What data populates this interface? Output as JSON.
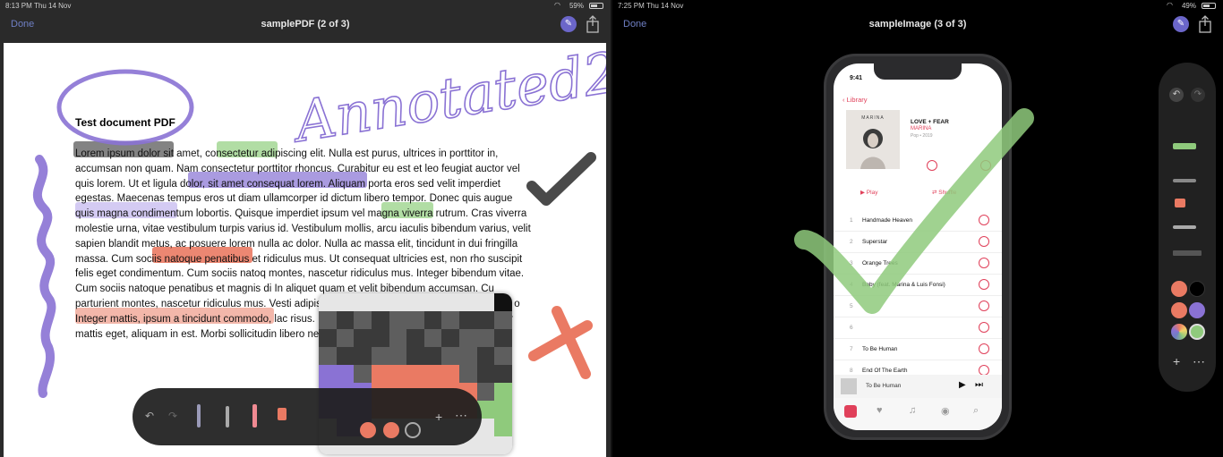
{
  "left": {
    "status": {
      "time": "8:13 PM",
      "date": "Thu 14 Nov",
      "battery": "59%"
    },
    "nav": {
      "done": "Done",
      "title": "samplePDF (2 of 3)"
    },
    "pdf": {
      "heading": "Test document PDF",
      "body": "Lorem ipsum dolor sit amet, consectetur adipiscing elit. Nulla est purus, ultrices in porttitor in, accumsan non quam. Nam consectetur porttitor rhoncus. Curabitur eu est et leo feugiat auctor vel quis lorem. Ut et ligula dolor, sit amet consequat lorem. Aliquam porta eros sed velit imperdiet egestas. Maecenas tempus eros ut diam ullamcorper id dictum libero tempor. Donec quis augue quis magna condimentum lobortis. Quisque imperdiet ipsum vel magna viverra rutrum. Cras viverra molestie urna, vitae vestibulum turpis varius id. Vestibulum mollis, arcu iaculis bibendum varius, velit sapien blandit metus, ac posuere lorem nulla ac dolor. Nulla ac massa elit, tincidunt in dui fringilla massa. Cum sociis natoque penatibus et ridiculus mus. Ut consequat ultricies est, non rho suscipit felis eget condimentum. Cum sociis natoq montes, nascetur ridiculus mus. Integer bibendum vitae. Cum sociis natoque penatibus et magnis di In aliquet quam et velit bibendum accumsan. Cu parturient montes, nascetur ridiculus mus. Vesti adipiscing at ac lacus. Praesent id pellentesque o Integer mattis, ipsum a tincidunt commodo, lac risus. In volu orci nec lon volutpat fel ullamcorper mattis eget, aliquam in est. Morbi sollicitudin libero nec augue dignissim ut",
      "annotation": "Annotated2"
    }
  },
  "right": {
    "status": {
      "time": "7:25 PM",
      "date": "Thu 14 Nov",
      "battery": "49%"
    },
    "nav": {
      "done": "Done",
      "title": "sampleImage (3 of 3)"
    },
    "phone": {
      "time": "9:41",
      "back": "Library",
      "album_art_text": "MARINA",
      "album_title": "LOVE + FEAR",
      "artist": "MARINA",
      "meta": "Pop • 2019",
      "play": "▶ Play",
      "shuffle": "⇄ Shuffle",
      "tracks": [
        {
          "num": "1",
          "name": "Handmade Heaven"
        },
        {
          "num": "2",
          "name": "Superstar"
        },
        {
          "num": "3",
          "name": "Orange Trees"
        },
        {
          "num": "4",
          "name": "Baby (feat. Marina & Luis Fonsi)"
        },
        {
          "num": "5",
          "name": ""
        },
        {
          "num": "6",
          "name": ""
        },
        {
          "num": "7",
          "name": "To Be Human"
        },
        {
          "num": "8",
          "name": "End Of The Earth"
        }
      ],
      "now_playing": "To Be Human"
    }
  },
  "colors": {
    "purple": "#8a72d4",
    "green": "#8fca7c",
    "salmon": "#ea7a63",
    "dark_gray": "#4a4a4a",
    "link_blue": "#6f7fc4",
    "music_red": "#e0405a"
  },
  "icons": {
    "undo": "undo-icon",
    "redo": "redo-icon",
    "pen": "pen-icon",
    "marker": "marker-icon",
    "pencil": "pencil-icon",
    "eraser": "eraser-icon",
    "ruler": "ruler-icon",
    "add": "plus-icon",
    "more": "more-icon",
    "share": "share-icon",
    "markup": "markup-icon"
  }
}
